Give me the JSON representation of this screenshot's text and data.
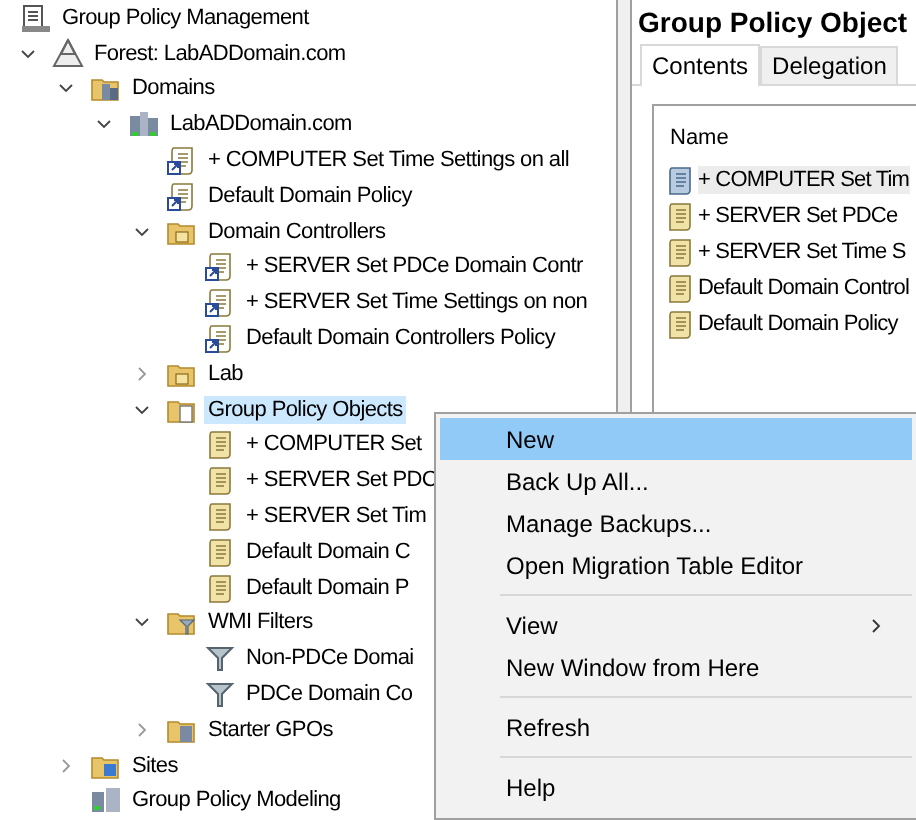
{
  "tree": [
    {
      "label": "Group Policy Management",
      "kind": "console",
      "children": [
        {
          "label": "Forest: LabADDomain.com",
          "kind": "forest",
          "expanded": true,
          "children": [
            {
              "label": "Domains",
              "kind": "domains",
              "expanded": true,
              "children": [
                {
                  "label": "LabADDomain.com",
                  "kind": "domain",
                  "expanded": true,
                  "children": [
                    {
                      "label": "+ COMPUTER Set Time Settings on all",
                      "kind": "gpo-link"
                    },
                    {
                      "label": "Default Domain Policy",
                      "kind": "gpo-link"
                    },
                    {
                      "label": "Domain Controllers",
                      "kind": "ou",
                      "expanded": true,
                      "children": [
                        {
                          "label": "+ SERVER Set PDCe Domain Contr",
                          "kind": "gpo-link"
                        },
                        {
                          "label": "+ SERVER Set Time Settings on non",
                          "kind": "gpo-link"
                        },
                        {
                          "label": "Default Domain Controllers Policy",
                          "kind": "gpo-link"
                        }
                      ]
                    },
                    {
                      "label": "Lab",
                      "kind": "ou",
                      "expanded": false
                    },
                    {
                      "label": "Group Policy Objects",
                      "kind": "gpo-folder",
                      "expanded": true,
                      "selected": true,
                      "children": [
                        {
                          "label": "+ COMPUTER Set",
                          "kind": "gpo"
                        },
                        {
                          "label": "+ SERVER Set PDC",
                          "kind": "gpo"
                        },
                        {
                          "label": "+ SERVER Set Tim",
                          "kind": "gpo"
                        },
                        {
                          "label": "Default Domain C",
                          "kind": "gpo"
                        },
                        {
                          "label": "Default Domain P",
                          "kind": "gpo"
                        }
                      ]
                    },
                    {
                      "label": "WMI Filters",
                      "kind": "wmi-folder",
                      "expanded": true,
                      "children": [
                        {
                          "label": "Non-PDCe Domai",
                          "kind": "wmi-filter"
                        },
                        {
                          "label": "PDCe Domain Co",
                          "kind": "wmi-filter"
                        }
                      ]
                    },
                    {
                      "label": "Starter GPOs",
                      "kind": "starter",
                      "expanded": false
                    }
                  ]
                }
              ]
            },
            {
              "label": "Sites",
              "kind": "sites",
              "expanded": false
            },
            {
              "label": "Group Policy Modeling",
              "kind": "modeling"
            }
          ]
        }
      ]
    }
  ],
  "details": {
    "title": "Group Policy Object",
    "tabs": [
      {
        "label": "Contents",
        "selected": true
      },
      {
        "label": "Delegation",
        "selected": false
      }
    ],
    "column": "Name",
    "rows": [
      {
        "label": "+ COMPUTER Set Tim",
        "kind": "linked",
        "selected": true
      },
      {
        "label": "+ SERVER Set PDCe",
        "kind": "plain",
        "selected": false
      },
      {
        "label": "+ SERVER Set Time S",
        "kind": "plain",
        "selected": false
      },
      {
        "label": "Default Domain Control",
        "kind": "plain",
        "selected": false
      },
      {
        "label": "Default Domain Policy",
        "kind": "plain",
        "selected": false
      }
    ]
  },
  "context_menu": [
    {
      "kind": "item",
      "label": "New",
      "selected": true
    },
    {
      "kind": "item",
      "label": "Back Up All...",
      "selected": false
    },
    {
      "kind": "item",
      "label": "Manage Backups...",
      "selected": false
    },
    {
      "kind": "item",
      "label": "Open Migration Table Editor",
      "selected": false
    },
    {
      "kind": "separator"
    },
    {
      "kind": "submenu",
      "label": "View",
      "selected": false
    },
    {
      "kind": "item",
      "label": "New Window from Here",
      "selected": false
    },
    {
      "kind": "separator"
    },
    {
      "kind": "item",
      "label": "Refresh",
      "selected": false
    },
    {
      "kind": "separator"
    },
    {
      "kind": "item",
      "label": "Help",
      "selected": false
    }
  ]
}
